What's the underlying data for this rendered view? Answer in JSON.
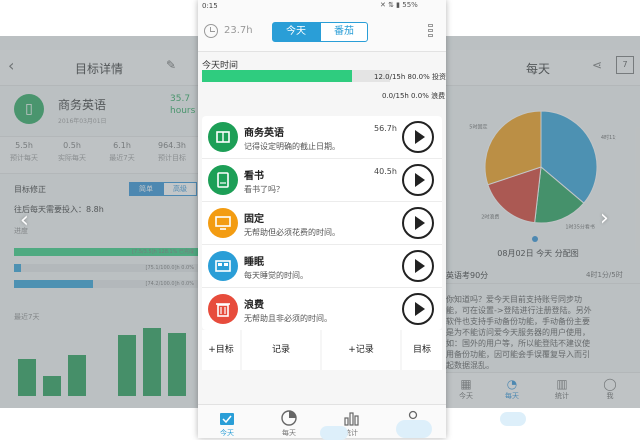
{
  "main": {
    "status": {
      "time": "0:15",
      "battery": "55%"
    },
    "topbar": {
      "total_hours": "23.7h",
      "tab_today": "今天",
      "tab_tomato": "番茄"
    },
    "today_section": {
      "label": "今天时间",
      "invest_bar": {
        "text": "12.0/15h 80.0% 投资",
        "fraction": 0.8
      },
      "waste_bar": {
        "text": "0.0/15h 0.0% 浪费",
        "fraction": 0.0
      }
    },
    "items": [
      {
        "name": "商务英语",
        "desc": "记得设定明确的截止日期。",
        "hours": "56.7h",
        "color": "#1d9f57",
        "icon": "book-icon"
      },
      {
        "name": "看书",
        "desc": "看书了吗？",
        "hours": "40.5h",
        "color": "#1d9f57",
        "icon": "tablet-icon"
      },
      {
        "name": "固定",
        "desc": "无帮助但必须花费的时间。",
        "hours": "",
        "color": "#f39c12",
        "icon": "monitor-icon"
      },
      {
        "name": "睡眠",
        "desc": "每天睡觉的时间。",
        "hours": "",
        "color": "#2a9ed7",
        "icon": "bed-icon"
      },
      {
        "name": "浪费",
        "desc": "无帮助且非必须的时间。",
        "hours": "",
        "color": "#e74c3c",
        "icon": "trash-icon"
      }
    ],
    "actions": [
      "+目标",
      "记录",
      "+记录",
      "目标"
    ],
    "nav": [
      "今天",
      "每天",
      "统计",
      "我"
    ]
  },
  "left": {
    "title": "目标详情",
    "goal_name": "商务英语",
    "goal_date": "2016年03月01日",
    "hours_value": "35.7",
    "hours_label": "hours",
    "stats": [
      {
        "value": "5.5h",
        "label": "预计每天"
      },
      {
        "value": "0.5h",
        "label": "实际每天"
      },
      {
        "value": "6.1h",
        "label": "最近7天"
      },
      {
        "value": "964.3h",
        "label": "预计目标"
      }
    ],
    "goal_edit_label": "目标修正",
    "seg_simple": "简单",
    "seg_advanced": "高级",
    "note": "往后每天需要投入：8.8h",
    "progress_label": "进度",
    "progress_bars": [
      {
        "text": "[7.5/3.5]h 128.1% 已完成",
        "fraction": 1.0,
        "color": "#2fcc7f"
      },
      {
        "text": "[75.1/100.0]h 0.0%",
        "fraction": 0.04,
        "color": "#2a9ed7"
      },
      {
        "text": "[74.2/100.0]h 0.0%",
        "fraction": 0.43,
        "color": "#2a9ed7"
      }
    ],
    "week_label": "最近7天",
    "week_values": [
      0.55,
      0.3,
      0.6,
      0.0,
      0.9,
      1.0,
      0.93
    ]
  },
  "right": {
    "title": "每天",
    "date_line": "08月02日 今天 分配图",
    "pie_slices": [
      {
        "label": "4时11分睡眠",
        "value": 0.3,
        "color": "#2a9ed7"
      },
      {
        "label": "1时35分看书",
        "value": 0.13,
        "color": "#1d9f57"
      },
      {
        "label": "2时浪费",
        "value": 0.15,
        "color": "#d63a2a"
      },
      {
        "label": "5时固定",
        "value": 0.25,
        "color": "#f39c12"
      }
    ],
    "list_row_left": "英语考90分",
    "list_row_right": "4时1分/5时",
    "info_text": "你知道吗？爱今天目前支持账号同步功能，可在设置->登陆进行注册登陆。另外软件也支持手动备份功能，手动备份主要是为不能访问爱今天服务器的用户使用，如：国外的用户等，所以能登陆不建议使用备份功能，因可能会手误覆复导入而引起数据混乱。",
    "tabs": [
      "今天",
      "每天",
      "统计",
      "我"
    ]
  }
}
